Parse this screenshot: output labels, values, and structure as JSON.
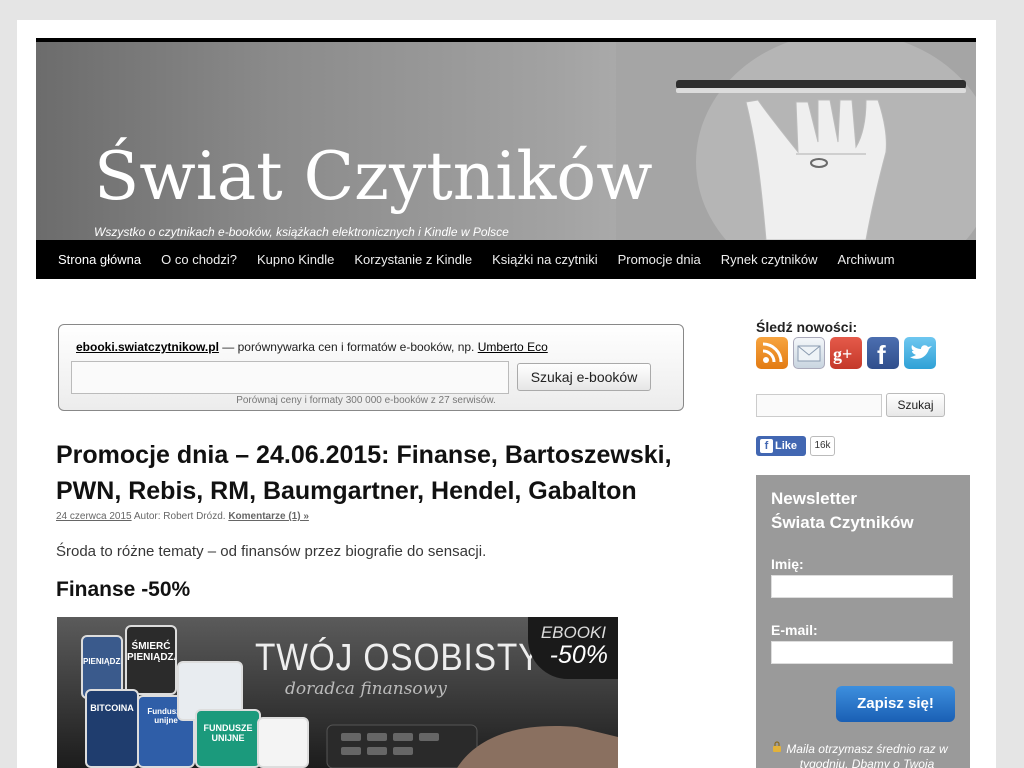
{
  "header": {
    "title": "Świat Czytników",
    "description": "Wszystko o czytnikach e-booków, książkach elektronicznych i Kindle w Polsce"
  },
  "nav": {
    "items": [
      {
        "label": "Strona główna"
      },
      {
        "label": "O co chodzi?"
      },
      {
        "label": "Kupno Kindle"
      },
      {
        "label": "Korzystanie z Kindle"
      },
      {
        "label": "Książki na czytniki"
      },
      {
        "label": "Promocje dnia"
      },
      {
        "label": "Rynek czytników"
      },
      {
        "label": "Archiwum"
      }
    ]
  },
  "ebooki": {
    "site": "ebooki.swiatczytnikow.pl",
    "text": " — porównywarka cen i formatów e-booków, np. ",
    "example": "Umberto Eco",
    "button": "Szukaj e-booków",
    "note": "Porównaj ceny i formaty 300 000 e-booków z 27 serwisów."
  },
  "post": {
    "title": "Promocje dnia – 24.06.2015: Finanse, Bartoszewski, PWN, Rebis, RM, Baumgartner, Hendel, Gabalton",
    "date": "24 czerwca 2015",
    "author": " Autor: Robert Drózd. ",
    "comments": "Komentarze (1) »",
    "lead": "Środa to różne tematy – od finansów przez biografie do sensacji.",
    "subheading": "Finanse -50%"
  },
  "banner": {
    "title": "TWÓJ OSOBISTY",
    "subtitle": "doradca finansowy",
    "corner_label": "EBOOKI",
    "corner_pct": "-50%",
    "books": [
      "PIENIĄDZE",
      "ŚMIERĆ PIENIĄDZA",
      "BITCOINA",
      "Fundusze unijne",
      "FUNDUSZE UNIJNE"
    ]
  },
  "sidebar": {
    "follow_label": "Śledź nowości:",
    "social_icons": [
      "rss-icon",
      "email-icon",
      "google-plus-icon",
      "facebook-icon",
      "twitter-icon"
    ],
    "search_button": "Szukaj",
    "fb_like": "Like",
    "fb_count": "16k",
    "newsletter": {
      "title_line1": "Newsletter",
      "title_line2": "Świata Czytników",
      "name_label": "Imię:",
      "email_label": "E-mail:",
      "button": "Zapisz się!",
      "note": "Maila otrzymasz średnio raz w tygodniu. Dbamy o Twoją"
    }
  },
  "colors": {
    "nav_bg": "#000000",
    "page_bg": "#e5e5e5",
    "newsletter_bg": "#9a9a9a",
    "button_blue": "#1a5fb4",
    "facebook_blue": "#4267b2"
  }
}
